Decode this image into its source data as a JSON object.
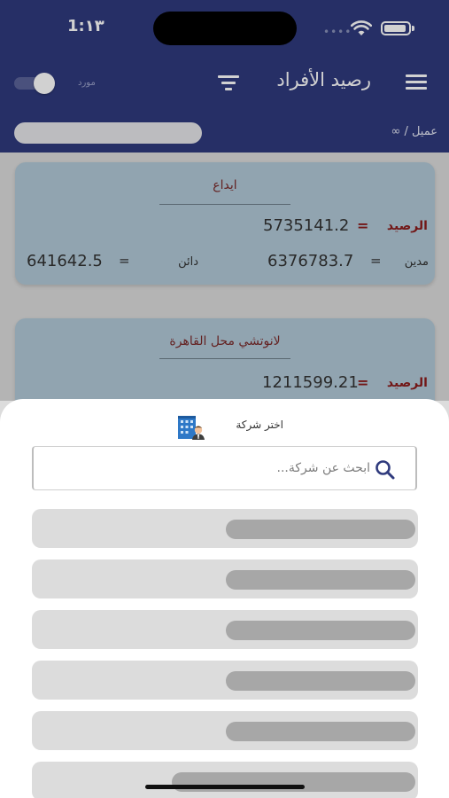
{
  "status_bar": {
    "time": "1:١٣",
    "signal_dots": "••••"
  },
  "header": {
    "title": "رصيد الأفراد",
    "toggle_label": "مورد",
    "toggle_on": true,
    "breadcrumb": "عميل / ∞"
  },
  "cards": [
    {
      "title": "ايداع",
      "balance_label": "الرصيد",
      "balance_eq": "=",
      "balance_value": "5735141.2",
      "debit_label": "مدين",
      "debit_eq": "=",
      "debit_value": "6376783.7",
      "credit_label": "دائن",
      "credit_eq": "=",
      "credit_value": "641642.5"
    },
    {
      "title": "لانوتشي محل القاهرة",
      "balance_label": "الرصيد",
      "balance_eq": "=",
      "balance_value": "1211599.21"
    }
  ],
  "sheet": {
    "title": "اختر شركة",
    "icon": "company-building-icon",
    "search_placeholder": "ابحث عن شركة...",
    "loading_rows": 6
  },
  "colors": {
    "header_bg": "#2f3a7d",
    "card_bg": "#b1c9d7",
    "balance_label": "#8b1c1c",
    "search_icon": "#2f3a7d"
  }
}
